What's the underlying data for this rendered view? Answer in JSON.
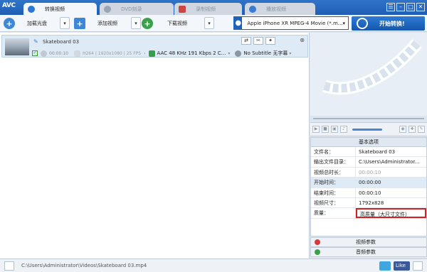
{
  "app": {
    "logo": "AVC"
  },
  "tabs": [
    {
      "label": "转换视频",
      "active": true
    },
    {
      "label": "DVD刻录",
      "active": false
    },
    {
      "label": "录制视频",
      "active": false
    },
    {
      "label": "播放视频",
      "active": false
    }
  ],
  "window": {
    "minimize": "–",
    "maximize": "□",
    "close": "✕",
    "settings": "☰"
  },
  "toolbar": {
    "load_disc": "加载光盘",
    "add_video": "添加视频",
    "download_video": "下载视频",
    "profile": "Apple iPhone XR MPEG-4 Movie (*.m...",
    "convert": "开始转换!"
  },
  "file": {
    "name": "Skateboard 03",
    "duration": "00:00:10",
    "video_info": "H264 | 1920x1080 | 25 FPS",
    "audio": "AAC 48 KHz 191 Kbps 2 C...",
    "subtitle": "No Subtitle 无字幕"
  },
  "options": {
    "header": "基本选项",
    "rows": [
      {
        "key": "文件名：",
        "value": "Skateboard 03"
      },
      {
        "key": "输出文件目录：",
        "value": "C:\\Users\\Administrator..."
      },
      {
        "key": "视频总时长：",
        "value": "00:00:10"
      },
      {
        "key": "开始时间：",
        "value": "00:00:00"
      },
      {
        "key": "结束时间：",
        "value": "00:00:10"
      },
      {
        "key": "视频尺寸：",
        "value": "1792x828"
      },
      {
        "key": "质量：",
        "value": "高质量（大尺寸文件）"
      }
    ],
    "video_params": "视频参数",
    "audio_params": "音频参数"
  },
  "status": {
    "path": "C:\\Users\\Administrator\\Videos\\Skateboard 03.mp4",
    "facebook": "Like"
  },
  "colors": {
    "accent": "#1f5eb4",
    "highlight": "#d62020"
  }
}
